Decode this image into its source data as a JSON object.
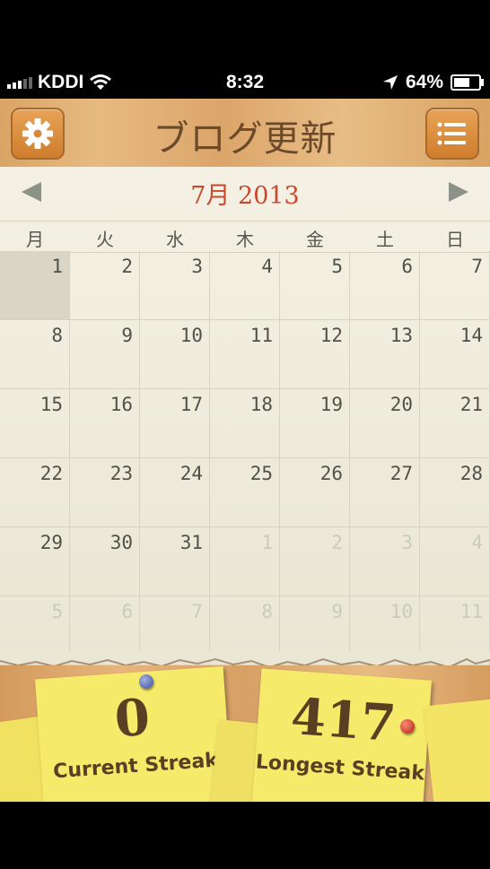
{
  "status_bar": {
    "carrier": "KDDI",
    "time": "8:32",
    "battery_percent": "64%",
    "battery_level": 0.64
  },
  "header": {
    "title": "ブログ更新",
    "settings_icon": "gear-icon",
    "menu_icon": "list-icon"
  },
  "calendar": {
    "month_label": "7月 2013",
    "weekdays": [
      "月",
      "火",
      "水",
      "木",
      "金",
      "土",
      "日"
    ],
    "weeks": [
      [
        "1",
        "2",
        "3",
        "4",
        "5",
        "6",
        "7"
      ],
      [
        "8",
        "9",
        "10",
        "11",
        "12",
        "13",
        "14"
      ],
      [
        "15",
        "16",
        "17",
        "18",
        "19",
        "20",
        "21"
      ],
      [
        "22",
        "23",
        "24",
        "25",
        "26",
        "27",
        "28"
      ],
      [
        "29",
        "30",
        "31",
        "1",
        "2",
        "3",
        "4"
      ],
      [
        "5",
        "6",
        "7",
        "8",
        "9",
        "10",
        "11"
      ]
    ]
  },
  "stats": {
    "current_streak_value": "0",
    "current_streak_label": "Current Streak",
    "longest_streak_value": "417",
    "longest_streak_label": "Longest Streak"
  },
  "colors": {
    "accent_red": "#c84a2e",
    "note_yellow": "#f6ea6a",
    "wood": "#dba56a"
  }
}
